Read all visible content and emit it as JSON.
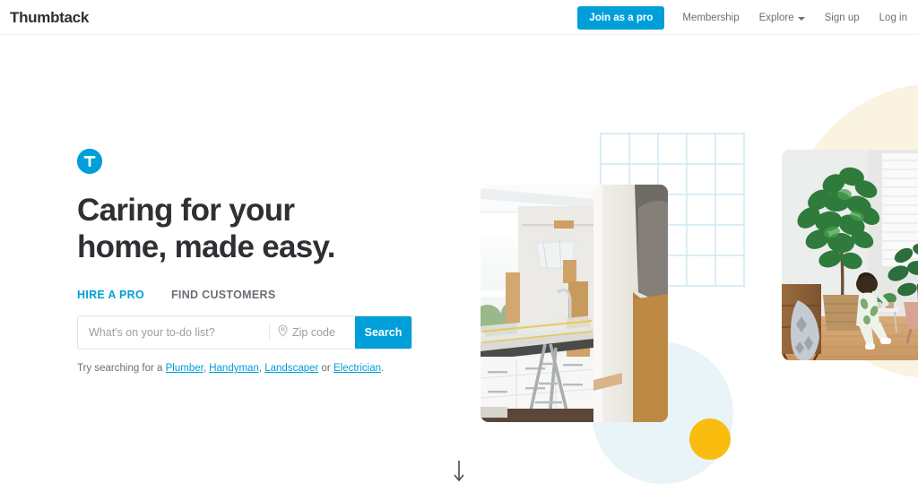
{
  "header": {
    "brand": "Thumbtack",
    "join_pro_label": "Join as a pro",
    "nav": [
      {
        "label": "Membership",
        "has_caret": false
      },
      {
        "label": "Explore",
        "has_caret": true
      },
      {
        "label": "Sign up",
        "has_caret": false
      },
      {
        "label": "Log in",
        "has_caret": false
      }
    ]
  },
  "hero": {
    "logo_icon": "thumbtack-badge-icon",
    "headline": "Caring for your\nhome, made easy.",
    "tabs": [
      {
        "label": "HIRE A PRO",
        "active": true
      },
      {
        "label": "FIND CUSTOMERS",
        "active": false
      }
    ],
    "search": {
      "query_value": "",
      "query_placeholder": "What's on your to-do list?",
      "zip_value": "",
      "zip_placeholder": "Zip code",
      "zip_icon": "location-pin-icon",
      "button_label": "Search"
    },
    "suggestions": {
      "prefix": "Try searching for a ",
      "links": [
        "Plumber",
        "Handyman",
        "Landscaper",
        "Electrician"
      ],
      "separator": ", ",
      "conjunction": " or ",
      "suffix": "."
    }
  },
  "decor": {
    "cream_circle_color": "#FAF3E1",
    "pale_blue_circle_color": "#E8F4F8",
    "yellow_dot_color": "#FBBC10",
    "grid_line_color": "#CDE7F2"
  },
  "photos": [
    {
      "name": "kitchen-renovation-photo",
      "alt": "Kitchen under renovation with masking paper, stepladder and white cabinets"
    },
    {
      "name": "living-room-plants-photo",
      "alt": "Child standing in a living room with a large fiddle-leaf fig and potted plants"
    }
  ],
  "footer": {
    "scroll_icon": "arrow-down-icon"
  },
  "colors": {
    "accent_blue": "#009FD9",
    "text_dark": "#2F3033",
    "text_muted": "#6B6E76"
  }
}
